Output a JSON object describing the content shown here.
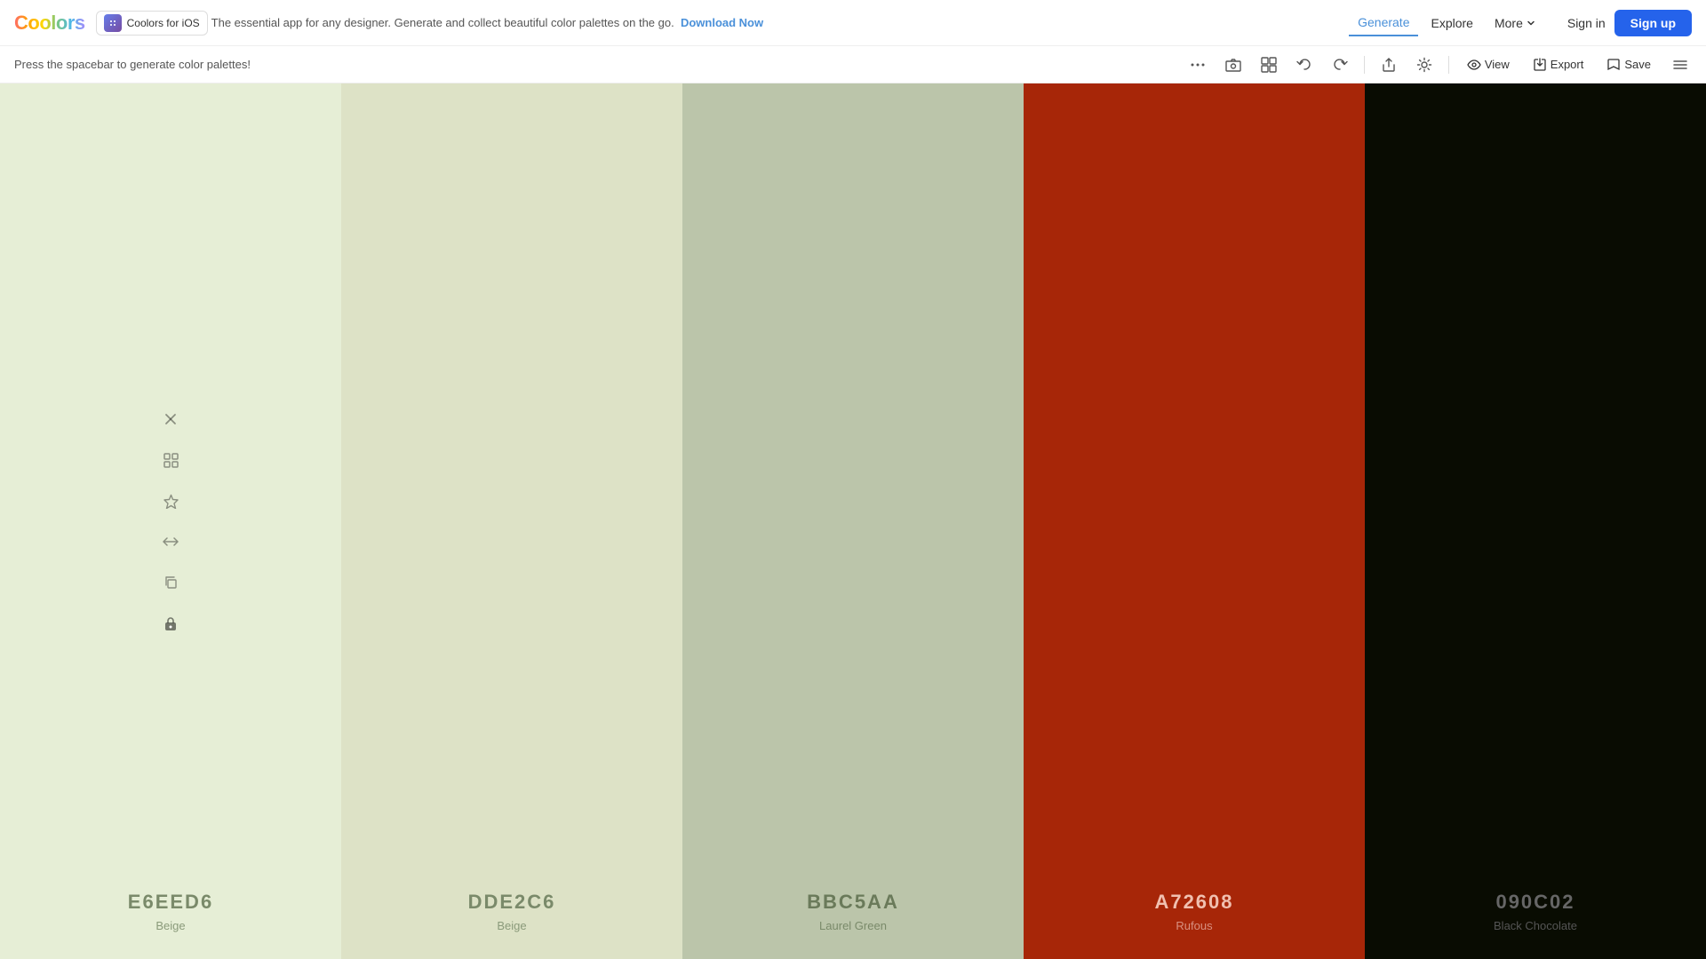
{
  "brand": {
    "name": "Coolors",
    "tagline": "Coolors for iOS",
    "promo_text": "The essential app for any designer. Generate and collect beautiful color palettes on the go.",
    "download_label": "Download Now"
  },
  "nav": {
    "generate_label": "Generate",
    "explore_label": "Explore",
    "more_label": "More",
    "sign_in_label": "Sign in",
    "sign_up_label": "Sign up"
  },
  "toolbar": {
    "spacebar_hint": "Press the spacebar to generate color palettes!",
    "view_label": "View",
    "export_label": "Export",
    "save_label": "Save"
  },
  "palette": {
    "colors": [
      {
        "hex": "E6EED6",
        "name": "Beige",
        "bg": "#E6EED6",
        "text_color": "#7a8a6a",
        "has_icons": true
      },
      {
        "hex": "DDE2C6",
        "name": "Beige",
        "bg": "#DDE2C6",
        "text_color": "#7a8a6a",
        "has_icons": false
      },
      {
        "hex": "BBC5AA",
        "name": "Laurel Green",
        "bg": "#BBC5AA",
        "text_color": "#6a7a5a",
        "has_icons": false
      },
      {
        "hex": "A72608",
        "name": "Rufous",
        "bg": "#A72608",
        "text_color": "#f0c0b0",
        "has_icons": false
      },
      {
        "hex": "090C02",
        "name": "Black Chocolate",
        "bg": "#090C02",
        "text_color": "#666",
        "has_icons": false
      }
    ]
  }
}
